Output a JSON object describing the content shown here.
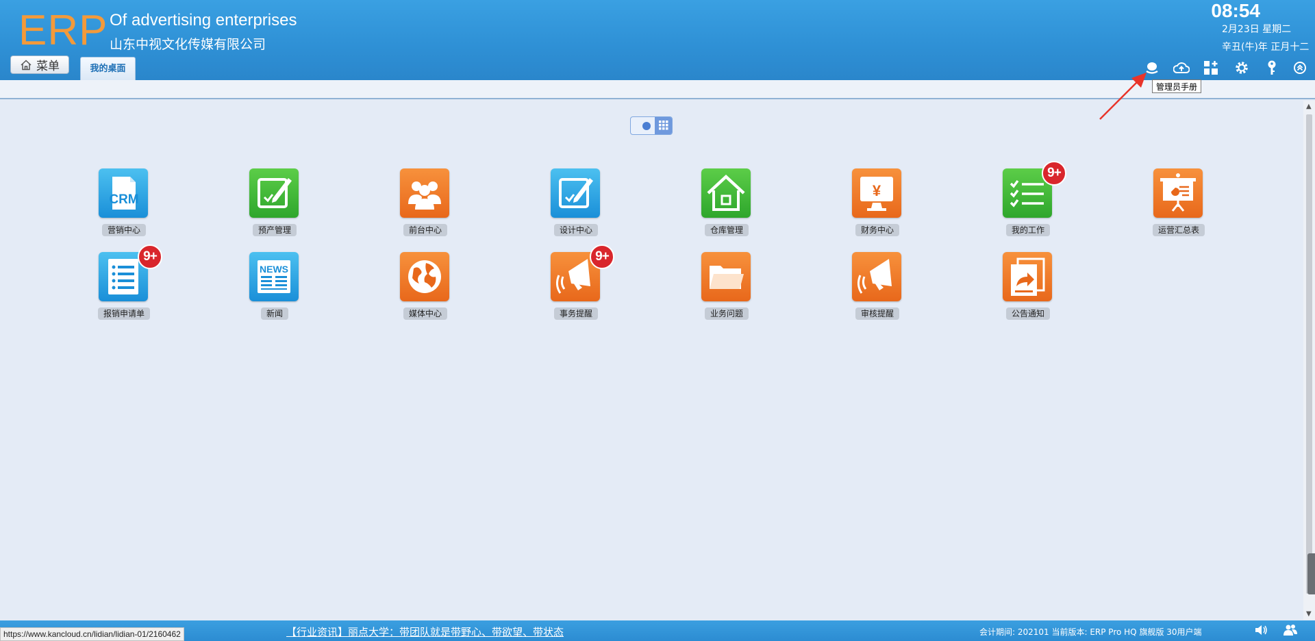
{
  "header": {
    "logo": "ERP",
    "company_en": "Of advertising enterprises",
    "company_cn": "山东中视文化传媒有限公司",
    "time": "08:54",
    "date": "2月23日 星期二",
    "lunar": "辛丑(牛)年 正月十二",
    "menu_label": "菜单",
    "tab_label": "我的桌面",
    "tooltip": "管理员手册",
    "toolbar_icons": [
      "admin-manual-icon",
      "cloud-upload-icon",
      "add-widget-icon",
      "settings-gear-icon",
      "key-icon",
      "collapse-icon"
    ]
  },
  "view_toggle": {
    "modes": [
      "circle-view",
      "grid-view"
    ],
    "active": "grid-view"
  },
  "apps": [
    {
      "label": "营销中心",
      "icon": "crm-icon",
      "color": "blue",
      "badge": ""
    },
    {
      "label": "预产管理",
      "icon": "edit-check-icon",
      "color": "green",
      "badge": ""
    },
    {
      "label": "前台中心",
      "icon": "people-icon",
      "color": "orange",
      "badge": ""
    },
    {
      "label": "设计中心",
      "icon": "design-edit-icon",
      "color": "blue",
      "badge": ""
    },
    {
      "label": "仓库管理",
      "icon": "warehouse-house-icon",
      "color": "green",
      "badge": ""
    },
    {
      "label": "财务中心",
      "icon": "finance-yen-monitor-icon",
      "color": "orange",
      "badge": ""
    },
    {
      "label": "我的工作",
      "icon": "checklist-icon",
      "color": "green",
      "badge": "9+"
    },
    {
      "label": "运营汇总表",
      "icon": "presentation-board-icon",
      "color": "orange",
      "badge": ""
    },
    {
      "label": "报销申请单",
      "icon": "list-document-icon",
      "color": "blue",
      "badge": "9+"
    },
    {
      "label": "新闻",
      "icon": "news-icon",
      "color": "blue",
      "badge": ""
    },
    {
      "label": "媒体中心",
      "icon": "globe-icon",
      "color": "orange",
      "badge": ""
    },
    {
      "label": "事务提醒",
      "icon": "megaphone-icon",
      "color": "orange",
      "badge": "9+"
    },
    {
      "label": "业务问题",
      "icon": "folder-icon",
      "color": "orange",
      "badge": ""
    },
    {
      "label": "审核提醒",
      "icon": "megaphone-icon",
      "color": "orange",
      "badge": ""
    },
    {
      "label": "公告通知",
      "icon": "share-document-icon",
      "color": "orange",
      "badge": ""
    }
  ],
  "footer": {
    "status_url": "https://www.kancloud.cn/lidian/lidian-01/2160462",
    "news": "【行业资讯】丽点大学：带团队就是带野心、带欲望、带状态",
    "info": "会计期间:  202101  当前版本:   ERP Pro HQ 旗舰版 30用户端"
  },
  "colors": {
    "header_blue": "#2f91d6",
    "logo_orange": "#f39a3a",
    "badge_red": "#d9262c"
  }
}
